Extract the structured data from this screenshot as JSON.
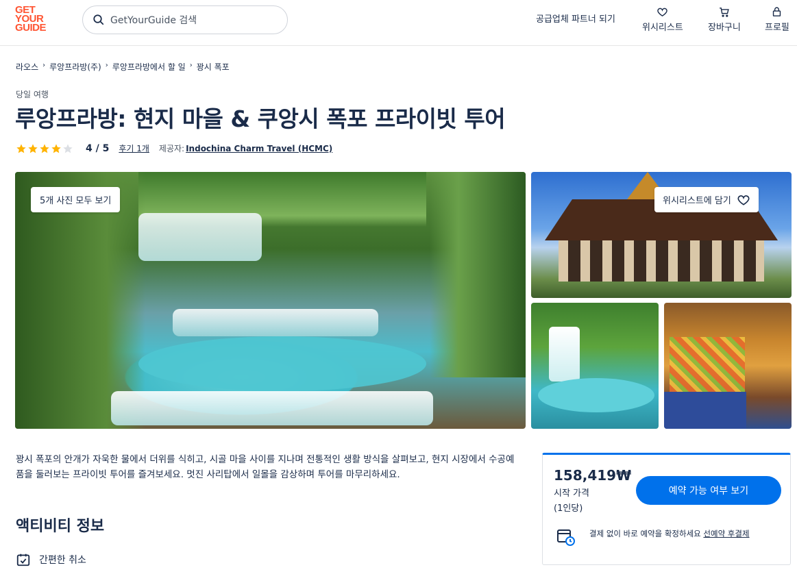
{
  "header": {
    "logo": [
      "GET",
      "YOUR",
      "GUIDE"
    ],
    "search_placeholder": "GetYourGuide 검색",
    "partner": "공급업체 파트너 되기",
    "wishlist": "위시리스트",
    "cart": "장바구니",
    "profile": "프로필"
  },
  "breadcrumb": [
    "라오스",
    "루앙프라방(주)",
    "루앙프라방에서 할 일",
    "꽝시 폭포"
  ],
  "category": "당일 여행",
  "title": "루앙프라방: 현지 마을 & 쿠앙시 폭포 프라이빗 투어",
  "rating": {
    "stars": 4,
    "value": "4 / 5",
    "reviews": "후기 1개",
    "provider_label": "제공자:",
    "provider": "Indochina Charm Travel (HCMC)"
  },
  "gallery": {
    "see_all": "5개 사진 모두 보기",
    "wishlist": "위시리스트에 담기"
  },
  "description": "꽝시 폭포의 안개가 자욱한 물에서 더위를 식히고, 시골 마을 사이를 지나며 전통적인 생활 방식을 살펴보고, 현지 시장에서 수공예품을 둘러보는 프라이빗 투어를 즐겨보세요. 멋진 사리탑에서 일몰을 감상하며 투어를 마무리하세요.",
  "activity": {
    "title": "액티비티 정보",
    "feature1": "간편한 취소"
  },
  "booking": {
    "price": "158,419₩",
    "from": "시작 가격",
    "per": "(1인당)",
    "cta": "예약 가능 여부 보기",
    "reserve_text": "결제 없이 바로 예약을 확정하세요 ",
    "reserve_link": "선예약 후결제"
  },
  "colors": {
    "brand": "#ff5533",
    "primary": "#0071eb",
    "text": "#1a2b49",
    "star": "#ffb300"
  }
}
